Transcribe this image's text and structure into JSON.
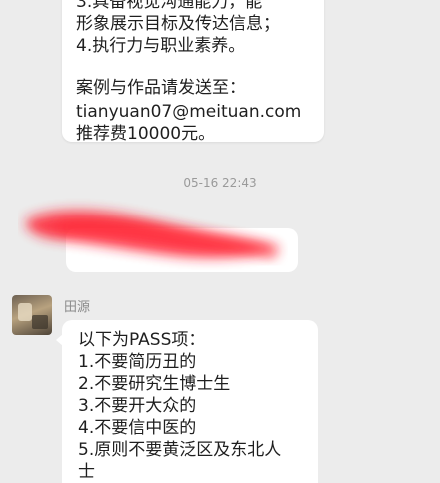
{
  "messages": {
    "first": {
      "lines": [
        "3.具备视觉沟通能力，能",
        "形象展示目标及传达信息；",
        "4.执行力与职业素养。",
        "",
        "案例与作品请发送至：",
        "tianyuan07@meituan.com",
        "推荐费10000元。"
      ]
    },
    "timestamp": "05-16 22:43",
    "second": {
      "sender": "田源",
      "lines": [
        "以下为PASS项：",
        "1.不要简历丑的",
        "2.不要研究生博士生",
        "3.不要开大众的",
        "4.不要信中医的",
        "5.原则不要黄泛区及东北人",
        "士"
      ]
    }
  },
  "colors": {
    "background": "#ececec",
    "bubble": "#ffffff",
    "redaction": "#ff1f2d"
  }
}
